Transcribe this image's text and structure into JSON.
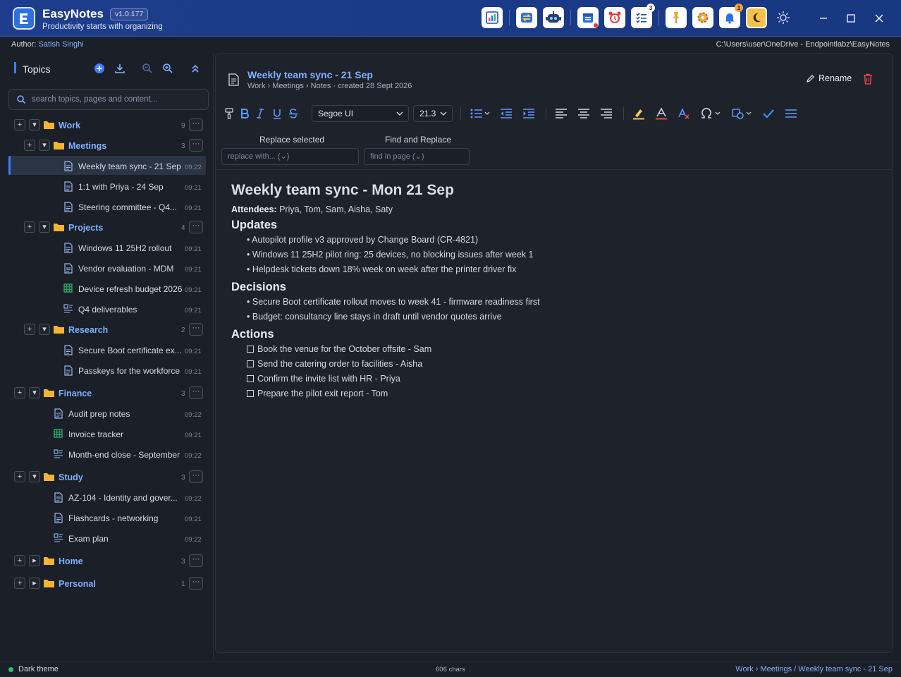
{
  "app": {
    "name": "EasyNotes",
    "version": "v1.0.177",
    "tagline": "Productivity starts with organizing",
    "toolbar_badges": {
      "tasks": "3",
      "notifications": "1"
    },
    "toolbar_icons": [
      "dashboard-icon",
      "sync-icon",
      "robot-icon",
      "calendar-icon",
      "alarm-icon",
      "checklist-icon",
      "pin-icon",
      "settings-icon",
      "bell-icon",
      "dark-mode-icon",
      "light-mode-icon"
    ],
    "colors": {
      "titlebar": "#1e3d8c",
      "accent": "#3d7eff",
      "link": "#7fb0ff",
      "active_button": "#f4c24b"
    }
  },
  "author": {
    "label": "Author:",
    "name": "Satish Singhi",
    "path": "C:\\Users\\user\\OneDrive - Endpointlabz\\EasyNotes"
  },
  "sidebar": {
    "title": "Topics",
    "search_placeholder": "search topics, pages and content...",
    "tree": {
      "work": {
        "label": "Work",
        "count": "9",
        "meetings": {
          "label": "Meetings",
          "count": "3",
          "pages": [
            {
              "label": "Weekly team sync - 21 Sep",
              "time": "09:22"
            },
            {
              "label": "1:1 with Priya - 24 Sep",
              "time": "09:21"
            },
            {
              "label": "Steering committee - Q4...",
              "time": "09:21"
            }
          ]
        },
        "projects": {
          "label": "Projects",
          "count": "4",
          "pages": [
            {
              "label": "Windows 11 25H2 rollout",
              "time": "09:21"
            },
            {
              "label": "Vendor evaluation - MDM",
              "time": "09:21"
            },
            {
              "label": "Device refresh budget 2026",
              "time": "09:21"
            },
            {
              "label": "Q4 deliverables",
              "time": "09:21"
            }
          ]
        },
        "research": {
          "label": "Research",
          "count": "2",
          "pages": [
            {
              "label": "Secure Boot certificate ex...",
              "time": "09:21"
            },
            {
              "label": "Passkeys for the workforce",
              "time": "09:21"
            }
          ]
        }
      },
      "finance": {
        "label": "Finance",
        "count": "3",
        "pages": [
          {
            "label": "Audit prep notes",
            "time": "09:22"
          },
          {
            "label": "Invoice tracker",
            "time": "09:21"
          },
          {
            "label": "Month-end close - September",
            "time": "09:22"
          }
        ]
      },
      "study": {
        "label": "Study",
        "count": "3",
        "pages": [
          {
            "label": "AZ-104 - Identity and gover...",
            "time": "09:22"
          },
          {
            "label": "Flashcards - networking",
            "time": "09:21"
          },
          {
            "label": "Exam plan",
            "time": "09:22"
          }
        ]
      },
      "home": {
        "label": "Home",
        "count": "3"
      },
      "personal": {
        "label": "Personal",
        "count": "1"
      }
    }
  },
  "editor": {
    "page_title": "Weekly team sync - 21 Sep",
    "breadcrumb": "Work › Meetings",
    "section": "Notes",
    "created": "created 28 Sept 2026",
    "rename_label": "Rename",
    "font_family": "Segoe UI",
    "font_size": "21.3",
    "replace_label": "Replace selected",
    "find_label": "Find and Replace",
    "replace_placeholder": "replace with... (⌄)",
    "find_placeholder": "find in page (⌄)"
  },
  "document": {
    "heading": "Weekly team sync - Mon 21 Sep",
    "attendees_label": "Attendees:",
    "attendees": "Priya, Tom, Sam, Aisha, Saty",
    "updates_heading": "Updates",
    "updates": [
      "Autopilot profile v3 approved by Change Board (CR-4821)",
      "Windows 11 25H2 pilot ring: 25 devices, no blocking issues after week 1",
      "Helpdesk tickets down 18% week on week after the printer driver fix"
    ],
    "decisions_heading": "Decisions",
    "decisions": [
      "Secure Boot certificate rollout moves to week 41 - firmware readiness first",
      "Budget: consultancy line stays in draft until vendor quotes arrive"
    ],
    "actions_heading": "Actions",
    "actions": [
      "Book the venue for the October offsite - Sam",
      "Send the catering order to facilities - Aisha",
      "Confirm the invite list with HR - Priya",
      "Prepare the pilot exit report - Tom"
    ]
  },
  "status": {
    "theme": "Dark theme",
    "chars": "606 chars",
    "crumb": "Work › Meetings / Weekly team sync - 21 Sep"
  }
}
